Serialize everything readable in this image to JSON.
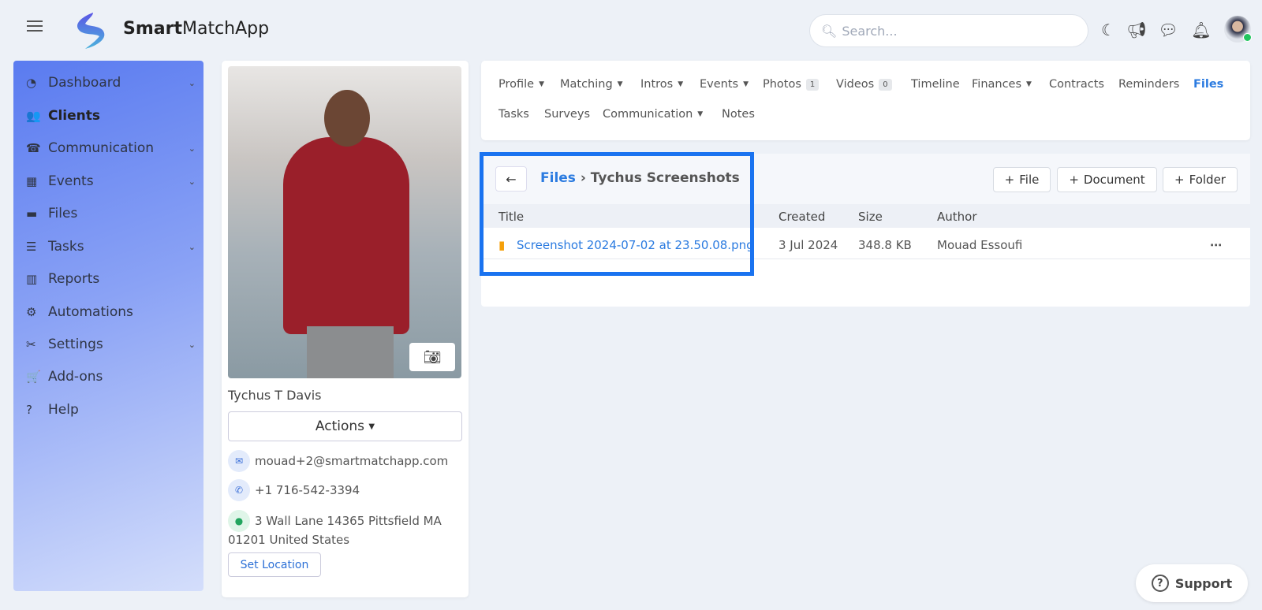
{
  "header": {
    "brand_bold": "Smart",
    "brand_rest": "MatchApp",
    "search_placeholder": "Search..."
  },
  "sidebar": {
    "items": [
      {
        "label": "Dashboard",
        "icon": "◔",
        "chev": true
      },
      {
        "label": "Clients",
        "icon": "👥",
        "active": true
      },
      {
        "label": "Communication",
        "icon": "☎",
        "chev": true
      },
      {
        "label": "Events",
        "icon": "▦",
        "chev": true
      },
      {
        "label": "Files",
        "icon": "▬"
      },
      {
        "label": "Tasks",
        "icon": "☰",
        "chev": true
      },
      {
        "label": "Reports",
        "icon": "▥"
      },
      {
        "label": "Automations",
        "icon": "⚙"
      },
      {
        "label": "Settings",
        "icon": "✂",
        "chev": true
      },
      {
        "label": "Add-ons",
        "icon": "🛒"
      },
      {
        "label": "Help",
        "icon": "?"
      }
    ]
  },
  "profile": {
    "name": "Tychus T Davis",
    "actions": "Actions",
    "email": "mouad+2@smartmatchapp.com",
    "phone": "+1 716-542-3394",
    "address1": "3 Wall Lane 14365 Pittsfield MA",
    "address2": "01201 United States",
    "set_location": "Set Location"
  },
  "tabs": {
    "profile": "Profile",
    "matching": "Matching",
    "intros": "Intros",
    "events": "Events",
    "photos": "Photos",
    "photos_count": "1",
    "videos": "Videos",
    "videos_count": "0",
    "timeline": "Timeline",
    "finances": "Finances",
    "contracts": "Contracts",
    "reminders": "Reminders",
    "files": "Files",
    "tasks": "Tasks",
    "surveys": "Surveys",
    "communication": "Communication",
    "notes": "Notes"
  },
  "files": {
    "crumb_root": "Files",
    "crumb_sep": "›",
    "crumb_current": "Tychus Screenshots",
    "btn_file": "File",
    "btn_document": "Document",
    "btn_folder": "Folder",
    "columns": {
      "title": "Title",
      "created": "Created",
      "size": "Size",
      "author": "Author"
    },
    "rows": [
      {
        "title": "Screenshot 2024-07-02 at 23.50.08.png",
        "created": "3 Jul 2024",
        "size": "348.8 KB",
        "author": "Mouad Essoufi"
      }
    ]
  },
  "support": "Support"
}
